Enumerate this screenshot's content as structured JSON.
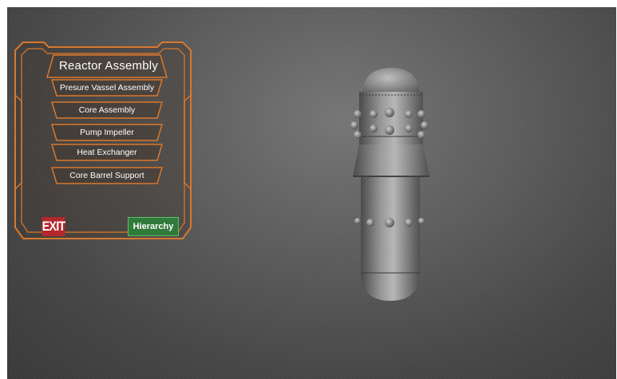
{
  "panel": {
    "title": "Reactor Assembly",
    "items": [
      {
        "label": "Presure Vassel Assembly"
      },
      {
        "label": "Core Assembly"
      },
      {
        "label": "Pump Impeller"
      },
      {
        "label": "Heat Exchanger"
      },
      {
        "label": "Core Barrel Support"
      }
    ],
    "exit_label": "EXIT",
    "hierarchy_label": "Hierarchy"
  },
  "colors": {
    "frame": "#d9782d",
    "exit": "#b5262c",
    "hierarchy": "#2f7a3a"
  }
}
